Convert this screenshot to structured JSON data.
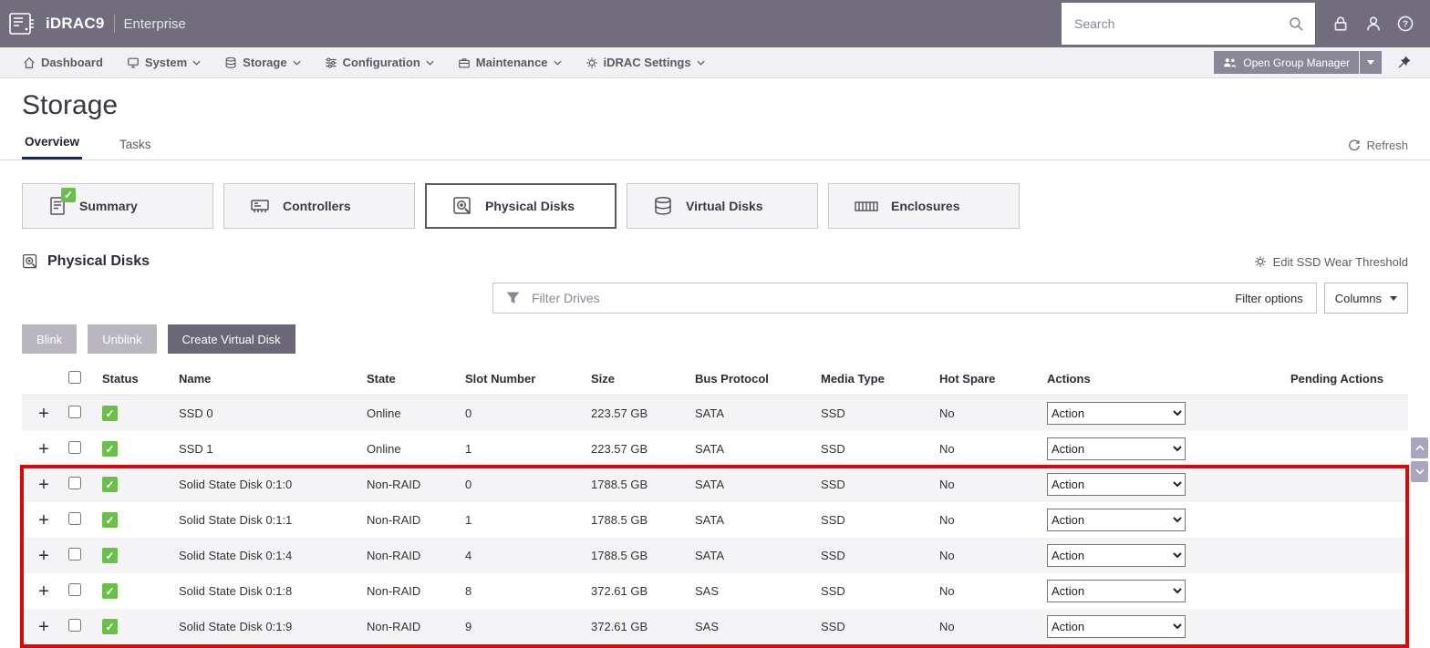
{
  "topbar": {
    "brand": "iDRAC9",
    "edition": "Enterprise",
    "search_placeholder": "Search"
  },
  "navbar": {
    "items": [
      {
        "label": "Dashboard"
      },
      {
        "label": "System"
      },
      {
        "label": "Storage"
      },
      {
        "label": "Configuration"
      },
      {
        "label": "Maintenance"
      },
      {
        "label": "iDRAC Settings"
      }
    ],
    "open_group_manager_label": "Open Group Manager"
  },
  "page": {
    "title": "Storage",
    "tab_overview": "Overview",
    "tab_tasks": "Tasks",
    "refresh_label": "Refresh"
  },
  "cards": {
    "summary": "Summary",
    "controllers": "Controllers",
    "physical_disks": "Physical Disks",
    "virtual_disks": "Virtual Disks",
    "enclosures": "Enclosures"
  },
  "section": {
    "title": "Physical Disks",
    "edit_ssd_wear_label": "Edit SSD Wear Threshold"
  },
  "filterbar": {
    "placeholder": "Filter Drives",
    "filter_options_label": "Filter options",
    "columns_label": "Columns"
  },
  "toolbar": {
    "blink_label": "Blink",
    "unblink_label": "Unblink",
    "create_vd_label": "Create Virtual Disk"
  },
  "table": {
    "headers": {
      "status": "Status",
      "name": "Name",
      "state": "State",
      "slot": "Slot Number",
      "size": "Size",
      "bus": "Bus Protocol",
      "media": "Media Type",
      "hot_spare": "Hot Spare",
      "actions": "Actions",
      "pending": "Pending Actions"
    },
    "action_label": "Action",
    "rows": [
      {
        "name": "SSD 0",
        "state": "Online",
        "slot": "0",
        "size": "223.57 GB",
        "bus": "SATA",
        "media": "SSD",
        "hot_spare": "No",
        "highlighted": false
      },
      {
        "name": "SSD 1",
        "state": "Online",
        "slot": "1",
        "size": "223.57 GB",
        "bus": "SATA",
        "media": "SSD",
        "hot_spare": "No",
        "highlighted": false
      },
      {
        "name": "Solid State Disk 0:1:0",
        "state": "Non-RAID",
        "slot": "0",
        "size": "1788.5 GB",
        "bus": "SATA",
        "media": "SSD",
        "hot_spare": "No",
        "highlighted": true
      },
      {
        "name": "Solid State Disk 0:1:1",
        "state": "Non-RAID",
        "slot": "1",
        "size": "1788.5 GB",
        "bus": "SATA",
        "media": "SSD",
        "hot_spare": "No",
        "highlighted": true
      },
      {
        "name": "Solid State Disk 0:1:4",
        "state": "Non-RAID",
        "slot": "4",
        "size": "1788.5 GB",
        "bus": "SATA",
        "media": "SSD",
        "hot_spare": "No",
        "highlighted": true
      },
      {
        "name": "Solid State Disk 0:1:8",
        "state": "Non-RAID",
        "slot": "8",
        "size": "372.61 GB",
        "bus": "SAS",
        "media": "SSD",
        "hot_spare": "No",
        "highlighted": true
      },
      {
        "name": "Solid State Disk 0:1:9",
        "state": "Non-RAID",
        "slot": "9",
        "size": "372.61 GB",
        "bus": "SAS",
        "media": "SSD",
        "hot_spare": "No",
        "highlighted": true
      }
    ]
  },
  "colors": {
    "topbar_bg": "#716d7c",
    "status_green": "#6abf4b",
    "annotation_red": "#dd0806",
    "tab_accent": "#1d2b49"
  }
}
